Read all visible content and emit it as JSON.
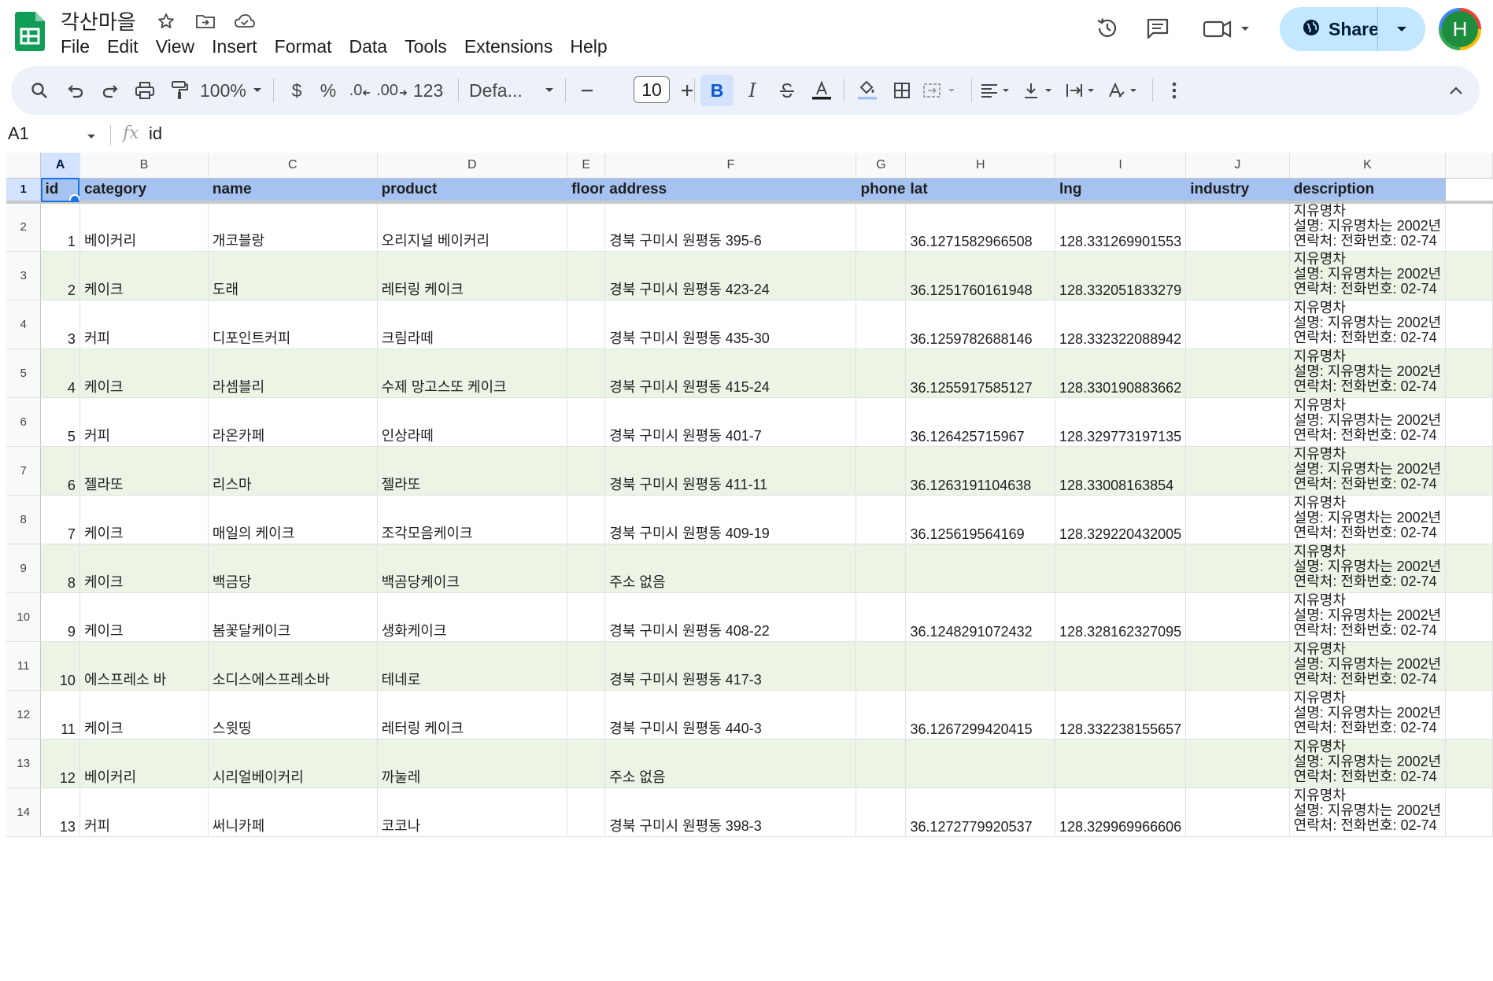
{
  "app": {
    "doc_title": "각산마을",
    "menu": [
      "File",
      "Edit",
      "View",
      "Insert",
      "Format",
      "Data",
      "Tools",
      "Extensions",
      "Help"
    ],
    "share_label": "Share",
    "avatar_initial": "H",
    "accent": "#1a73e8",
    "header_fill": "#a5c2f0",
    "band_fill": "#ecf4e6"
  },
  "toolbar": {
    "zoom": "100%",
    "currency": "$",
    "percent": "%",
    "dec_decrease": ".0",
    "dec_increase": ".00",
    "number_format": "123",
    "font_name": "Defa...",
    "font_size": "10",
    "bold": "B",
    "italic": "I",
    "icons": [
      "search-icon",
      "undo-icon",
      "redo-icon",
      "print-icon",
      "paint-format-icon",
      "minus-icon",
      "plus-icon",
      "strikethrough-icon",
      "text-color-icon",
      "fill-color-icon",
      "borders-icon",
      "merge-icon",
      "align-icon",
      "valign-icon",
      "text-direction-icon",
      "text-rotation-icon",
      "more-icon",
      "collapse-icon"
    ]
  },
  "formula_bar": {
    "cell_ref": "A1",
    "fx": "fx",
    "value": "id"
  },
  "sheet": {
    "columns": [
      "A",
      "B",
      "C",
      "D",
      "E",
      "F",
      "G",
      "H",
      "I",
      "J",
      "K"
    ],
    "header": [
      "id",
      "category",
      "name",
      "product",
      "floor",
      "address",
      "phone",
      "lat",
      "lng",
      "industry",
      "description"
    ],
    "rows": [
      {
        "num": "2",
        "id": "1",
        "category": "베이커리",
        "name": "개코블랑",
        "product": "오리지널 베이커리",
        "floor": "",
        "address": "경북 구미시 원평동 395-6",
        "phone": "",
        "lat": "36.1271582966508",
        "lng": "128.331269901553",
        "industry": "",
        "desc": [
          "지유명차",
          "설명: 지유명차는 2002년",
          "연락처: 전화번호: 02-74"
        ]
      },
      {
        "num": "3",
        "id": "2",
        "category": "케이크",
        "name": "도래",
        "product": "레터링 케이크",
        "floor": "",
        "address": "경북 구미시 원평동 423-24",
        "phone": "",
        "lat": "36.1251760161948",
        "lng": "128.332051833279",
        "industry": "",
        "desc": [
          "지유명차",
          "설명: 지유명차는 2002년",
          "연락처: 전화번호: 02-74"
        ]
      },
      {
        "num": "4",
        "id": "3",
        "category": "커피",
        "name": "디포인트커피",
        "product": "크림라떼",
        "floor": "",
        "address": "경북 구미시 원평동 435-30",
        "phone": "",
        "lat": "36.1259782688146",
        "lng": "128.332322088942",
        "industry": "",
        "desc": [
          "지유명차",
          "설명: 지유명차는 2002년",
          "연락처: 전화번호: 02-74"
        ]
      },
      {
        "num": "5",
        "id": "4",
        "category": "케이크",
        "name": "라셈블리",
        "product": "수제 망고스또 케이크",
        "floor": "",
        "address": "경북 구미시 원평동 415-24",
        "phone": "",
        "lat": "36.1255917585127",
        "lng": "128.330190883662",
        "industry": "",
        "desc": [
          "지유명차",
          "설명: 지유명차는 2002년",
          "연락처: 전화번호: 02-74"
        ]
      },
      {
        "num": "6",
        "id": "5",
        "category": "커피",
        "name": "라온카페",
        "product": "인상라떼",
        "floor": "",
        "address": "경북 구미시 원평동 401-7",
        "phone": "",
        "lat": "36.126425715967",
        "lng": "128.329773197135",
        "industry": "",
        "desc": [
          "지유명차",
          "설명: 지유명차는 2002년",
          "연락처: 전화번호: 02-74"
        ]
      },
      {
        "num": "7",
        "id": "6",
        "category": "젤라또",
        "name": "리스마",
        "product": "젤라또",
        "floor": "",
        "address": "경북 구미시 원평동 411-11",
        "phone": "",
        "lat": "36.1263191104638",
        "lng": "128.33008163854",
        "industry": "",
        "desc": [
          "지유명차",
          "설명: 지유명차는 2002년",
          "연락처: 전화번호: 02-74"
        ]
      },
      {
        "num": "8",
        "id": "7",
        "category": "케이크",
        "name": "매일의 케이크",
        "product": "조각모음케이크",
        "floor": "",
        "address": "경북 구미시 원평동 409-19",
        "phone": "",
        "lat": "36.125619564169",
        "lng": "128.329220432005",
        "industry": "",
        "desc": [
          "지유명차",
          "설명: 지유명차는 2002년",
          "연락처: 전화번호: 02-74"
        ]
      },
      {
        "num": "9",
        "id": "8",
        "category": "케이크",
        "name": "백금당",
        "product": "백곰당케이크",
        "floor": "",
        "address": "주소 없음",
        "phone": "",
        "lat": "",
        "lng": "",
        "industry": "",
        "desc": [
          "지유명차",
          "설명: 지유명차는 2002년",
          "연락처: 전화번호: 02-74"
        ]
      },
      {
        "num": "10",
        "id": "9",
        "category": "케이크",
        "name": "봄꽃달케이크",
        "product": "생화케이크",
        "floor": "",
        "address": "경북 구미시 원평동 408-22",
        "phone": "",
        "lat": "36.1248291072432",
        "lng": "128.328162327095",
        "industry": "",
        "desc": [
          "지유명차",
          "설명: 지유명차는 2002년",
          "연락처: 전화번호: 02-74"
        ]
      },
      {
        "num": "11",
        "id": "10",
        "category": "에스프레소 바",
        "name": "소디스에스프레소바",
        "product": "테네로",
        "floor": "",
        "address": "경북 구미시 원평동 417-3",
        "phone": "",
        "lat": "",
        "lng": "",
        "industry": "",
        "desc": [
          "지유명차",
          "설명: 지유명차는 2002년",
          "연락처: 전화번호: 02-74"
        ]
      },
      {
        "num": "12",
        "id": "11",
        "category": "케이크",
        "name": "스윗띵",
        "product": "레터링 케이크",
        "floor": "",
        "address": "경북 구미시 원평동 440-3",
        "phone": "",
        "lat": "36.1267299420415",
        "lng": "128.332238155657",
        "industry": "",
        "desc": [
          "지유명차",
          "설명: 지유명차는 2002년",
          "연락처: 전화번호: 02-74"
        ]
      },
      {
        "num": "13",
        "id": "12",
        "category": "베이커리",
        "name": "시리얼베이커리",
        "product": "까눌레",
        "floor": "",
        "address": "주소 없음",
        "phone": "",
        "lat": "",
        "lng": "",
        "industry": "",
        "desc": [
          "지유명차",
          "설명: 지유명차는 2002년",
          "연락처: 전화번호: 02-74"
        ]
      },
      {
        "num": "14",
        "id": "13",
        "category": "커피",
        "name": "써니카페",
        "product": "코코나",
        "floor": "",
        "address": "경북 구미시 원평동 398-3",
        "phone": "",
        "lat": "36.1272779920537",
        "lng": "128.329969966606",
        "industry": "",
        "desc": [
          "지유명차",
          "설명: 지유명차는 2002년",
          "연락처: 전화번호: 02-74"
        ]
      }
    ]
  }
}
